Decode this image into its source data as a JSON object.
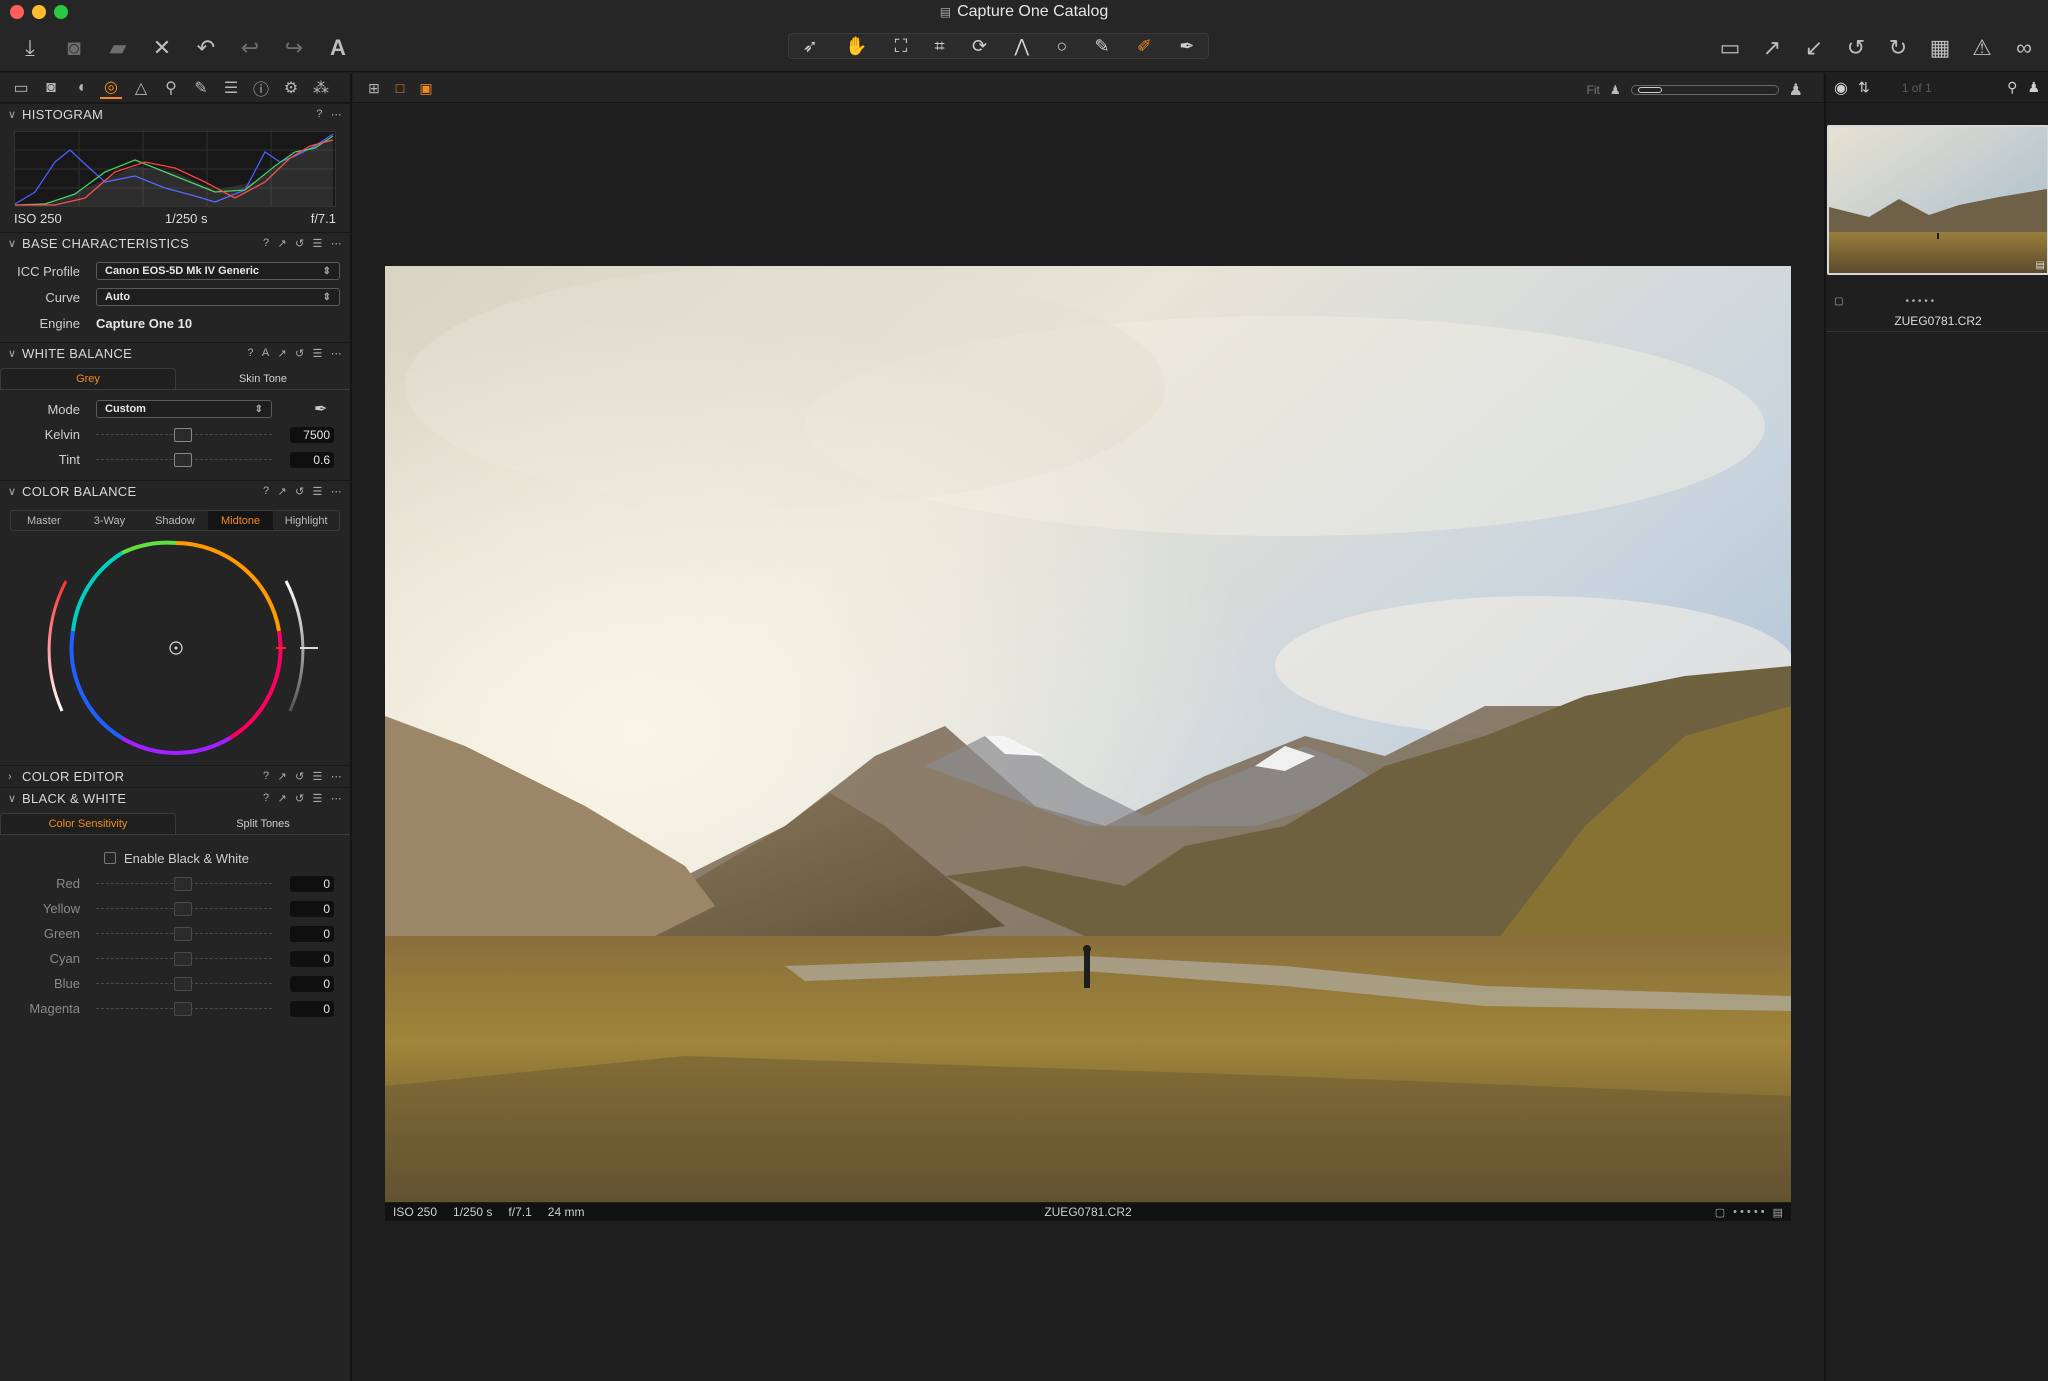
{
  "window": {
    "title": "Capture One Catalog"
  },
  "toolbar": {
    "left_icons": [
      "import-icon",
      "camera-icon",
      "folder-icon",
      "delete-icon",
      "undo-history-icon",
      "undo-icon",
      "redo-icon",
      "text-icon"
    ],
    "center_tools": [
      "select-cursor-icon",
      "pan-hand-icon",
      "crop-overlay-icon",
      "crop-icon",
      "rotate-icon",
      "keystone-icon",
      "circle-mask-icon",
      "brush-icon",
      "draw-mask-icon",
      "picker-icon"
    ],
    "right_icons": [
      "stack-icon",
      "export-icon",
      "import-arrow-icon",
      "rotate-left-icon",
      "rotate-right-icon",
      "grid-icon",
      "warning-icon",
      "glasses-icon"
    ]
  },
  "colors": {
    "accent": "#f08a24",
    "panel": "#242424",
    "background": "#1e1e1e"
  },
  "histogram": {
    "title": "HISTOGRAM",
    "iso": "ISO 250",
    "shutter": "1/250 s",
    "aperture": "f/7.1"
  },
  "base_characteristics": {
    "title": "BASE CHARACTERISTICS",
    "icc_label": "ICC Profile",
    "icc_value": "Canon EOS-5D Mk IV Generic",
    "curve_label": "Curve",
    "curve_value": "Auto",
    "engine_label": "Engine",
    "engine_value": "Capture One 10"
  },
  "white_balance": {
    "title": "WHITE BALANCE",
    "tabs": [
      "Grey",
      "Skin Tone"
    ],
    "mode_label": "Mode",
    "mode_value": "Custom",
    "kelvin_label": "Kelvin",
    "kelvin_value": "7500",
    "tint_label": "Tint",
    "tint_value": "0.6"
  },
  "color_balance": {
    "title": "COLOR BALANCE",
    "tabs": [
      "Master",
      "3-Way",
      "Shadow",
      "Midtone",
      "Highlight"
    ],
    "active_tab": "Midtone"
  },
  "color_editor": {
    "title": "COLOR EDITOR"
  },
  "black_white": {
    "title": "BLACK & WHITE",
    "tabs": [
      "Color Sensitivity",
      "Split Tones"
    ],
    "enable_label": "Enable Black & White",
    "sliders": [
      {
        "label": "Red",
        "value": "0"
      },
      {
        "label": "Yellow",
        "value": "0"
      },
      {
        "label": "Green",
        "value": "0"
      },
      {
        "label": "Cyan",
        "value": "0"
      },
      {
        "label": "Blue",
        "value": "0"
      },
      {
        "label": "Magenta",
        "value": "0"
      }
    ]
  },
  "viewer": {
    "zoom_label": "Fit",
    "info": {
      "iso": "ISO 250",
      "shutter": "1/250 s",
      "aperture": "f/7.1",
      "focal": "24 mm"
    },
    "filename": "ZUEG0781.CR2"
  },
  "browser": {
    "count": "1 of 1",
    "thumb_name": "ZUEG0781.CR2",
    "rating_dots": "• • • • •"
  }
}
